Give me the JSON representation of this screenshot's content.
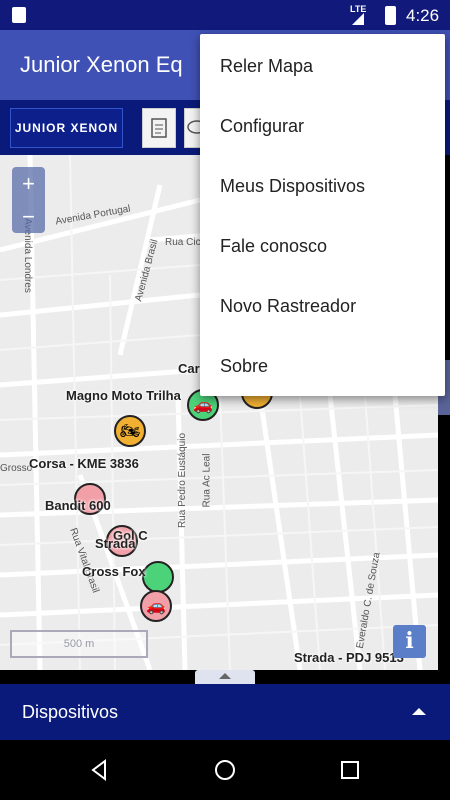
{
  "status_bar": {
    "time": "4:26",
    "network": "LTE"
  },
  "app_bar": {
    "title": "Junior Xenon Eq"
  },
  "toolbar": {
    "logo_text": "JUNIOR XENON"
  },
  "map": {
    "zoom_in": "+",
    "zoom_out": "−",
    "scale_label": "500 m",
    "info_label": "i",
    "streets": [
      "Avenida Portugal",
      "Avenida Londres",
      "Avenida Brasil",
      "Rua Cicer",
      "Rua Vital Brasil",
      "Rua Pedro Eustáquio",
      "Rua Ac Leal",
      "Everaldo C. de Souza",
      "Grosso"
    ],
    "vehicle_labels": [
      "Magno Moto Trilha",
      "Corsa - KME 3836",
      "Bandit 600",
      "Strada",
      "Gol C",
      "Cross Fox",
      "Strada - PDJ 9513",
      "Car"
    ]
  },
  "overflow_menu": {
    "items": [
      "Reler Mapa",
      "Configurar",
      "Meus Dispositivos",
      "Fale conosco",
      "Novo Rastreador",
      "Sobre"
    ]
  },
  "bottom_panel": {
    "label": "Dispositivos"
  },
  "colors": {
    "status_bar": "#111a7a",
    "app_bar": "#3f51b5",
    "toolbar": "#0a1a7a",
    "marker_green": "#4cd37a",
    "marker_orange": "#f2b033",
    "marker_pink": "#f2a0a8"
  }
}
